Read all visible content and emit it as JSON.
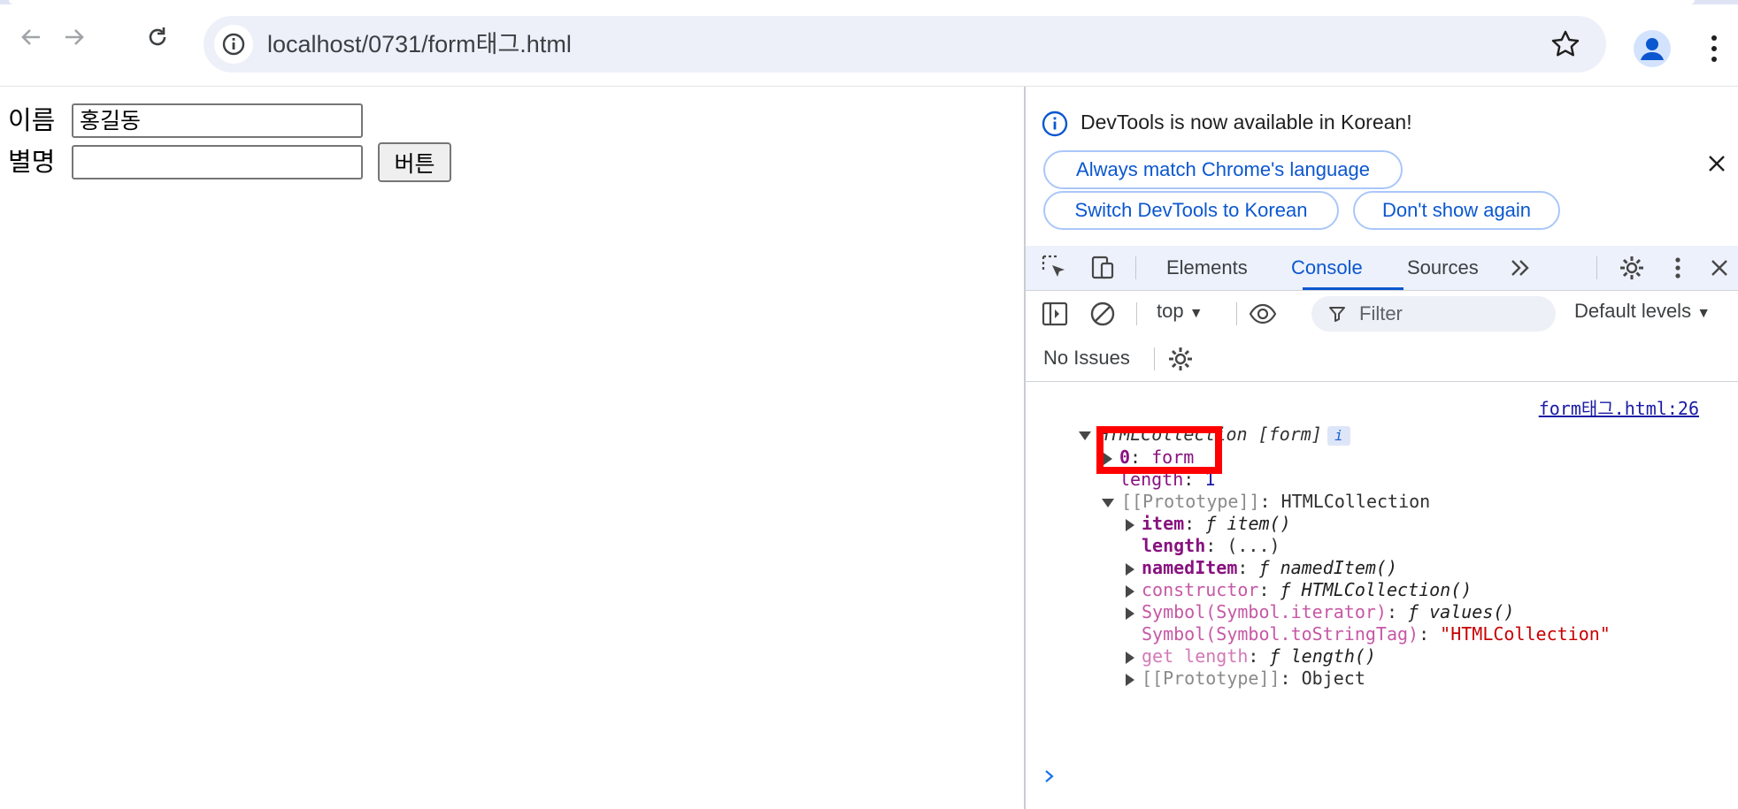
{
  "browser": {
    "url": "localhost/0731/form태그.html"
  },
  "page": {
    "name_label": "이름",
    "name_value": "홍길동",
    "nickname_label": "별명",
    "nickname_value": "",
    "button_label": "버튼"
  },
  "devtools": {
    "info_message": "DevTools is now available in Korean!",
    "btn_always_match": "Always match Chrome's language",
    "btn_switch_korean": "Switch DevTools to Korean",
    "btn_dont_show": "Don't show again",
    "tabs": [
      "Elements",
      "Console",
      "Sources"
    ],
    "active_tab": "Console",
    "context": "top",
    "filter_placeholder": "Filter",
    "levels": "Default levels",
    "issues": "No Issues",
    "accent_color": "#0b57d0"
  },
  "console": {
    "source_link": "form태그.html:26",
    "collection_label": "HTMLCollection [form]",
    "info_badge": "i",
    "entries": {
      "e0_key": "0",
      "e0_val": "form",
      "len_key": "length",
      "len_val": "1",
      "proto_key": "[[Prototype]]",
      "proto_val": "HTMLCollection",
      "item_key": "item",
      "item_val": "item()",
      "length2_key": "length",
      "length2_val": "(...)",
      "nameditem_key": "namedItem",
      "nameditem_val": "namedItem()",
      "ctor_key": "constructor",
      "ctor_val": "HTMLCollection()",
      "iter_key": "Symbol(Symbol.iterator)",
      "iter_val": "values()",
      "tag_key": "Symbol(Symbol.toStringTag)",
      "tag_val": "\"HTMLCollection\"",
      "getlen_key": "get length",
      "getlen_val": "length()",
      "proto2_key": "[[Prototype]]",
      "proto2_val": "Object",
      "fn_glyph": "ƒ"
    }
  }
}
